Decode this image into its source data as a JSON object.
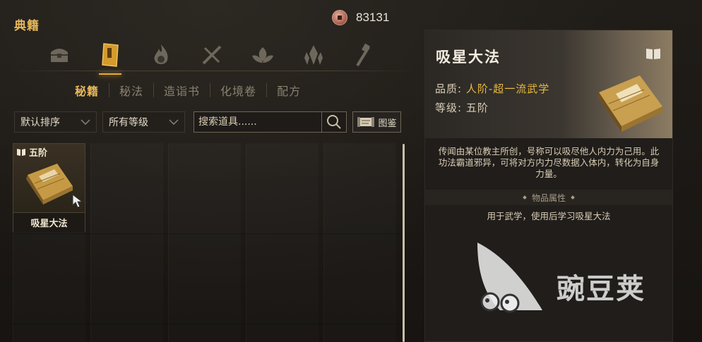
{
  "header": {
    "title": "典籍",
    "currency_value": "83131"
  },
  "categories": [
    {
      "name": "chest",
      "active": false
    },
    {
      "name": "manual",
      "active": true
    },
    {
      "name": "flame",
      "active": false
    },
    {
      "name": "crossed-blades",
      "active": false
    },
    {
      "name": "lotus",
      "active": false
    },
    {
      "name": "crystal",
      "active": false
    },
    {
      "name": "sword-hammer",
      "active": false
    }
  ],
  "subtabs": [
    {
      "label": "秘籍",
      "active": true
    },
    {
      "label": "秘法",
      "active": false
    },
    {
      "label": "造诣书",
      "active": false
    },
    {
      "label": "化境卷",
      "active": false
    },
    {
      "label": "配方",
      "active": false
    }
  ],
  "filters": {
    "sort_label": "默认排序",
    "level_label": "所有等级",
    "search_placeholder": "搜索道具......",
    "tujian_label": "图鉴"
  },
  "items": [
    {
      "tier": "五阶",
      "name": "吸星大法",
      "selected": true
    }
  ],
  "detail": {
    "title": "吸星大法",
    "quality_label": "品质:",
    "quality_value": "人阶-超一流武学",
    "level_label": "等级:",
    "level_value": "五阶",
    "description": "传闻由某位教主所创，号称可以吸尽他人内力为己用。此功法霸道邪异，可将对方内力尽数据入体内，转化为自身力量。",
    "props_header": "物品属性",
    "props_text": "用于武学，使用后学习吸星大法"
  },
  "watermark": {
    "text": "豌豆荚"
  },
  "colors": {
    "accent": "#e8a93a",
    "quality": "#e8b83e"
  }
}
